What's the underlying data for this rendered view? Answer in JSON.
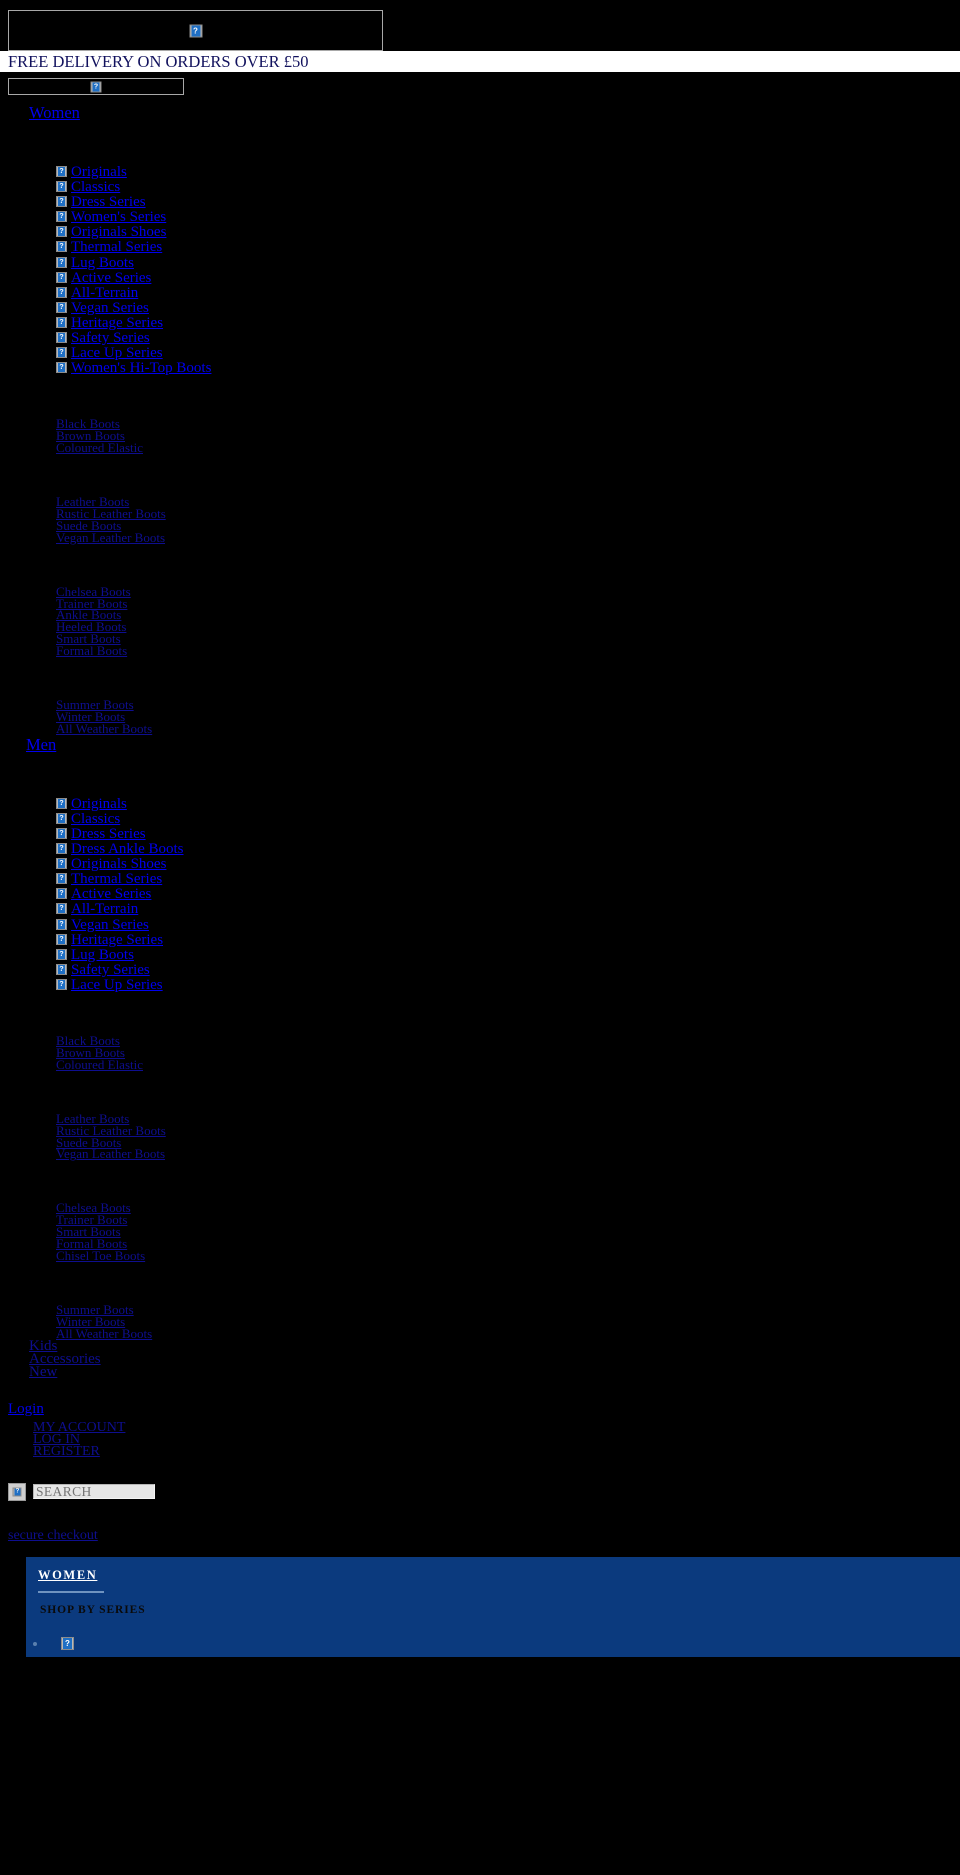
{
  "promo": {
    "text": "FREE DELIVERY ON ORDERS OVER £50"
  },
  "icons": {
    "broken": "broken-image-placeholder",
    "search": "search-icon"
  },
  "nav": {
    "women_label": "Women",
    "men_label": "Men",
    "kids_label": "Kids",
    "accessories_label": "Accessories",
    "new_label": "New",
    "women_series": [
      "Originals",
      "Classics",
      "Dress Series",
      "Women's Series",
      "Originals Shoes",
      "Thermal Series",
      "Lug Boots",
      "Active Series",
      "All-Terrain",
      "Vegan Series",
      "Heritage Series",
      "Safety Series",
      "Lace Up Series",
      "Women's Hi-Top Boots"
    ],
    "women_colour": [
      "Black Boots",
      "Brown Boots",
      "Coloured Elastic"
    ],
    "women_material": [
      "Leather Boots",
      "Rustic Leather Boots",
      "Suede Boots",
      "Vegan Leather Boots"
    ],
    "women_style": [
      "Chelsea Boots",
      "Trainer Boots",
      "Ankle Boots",
      "Heeled Boots",
      "Smart Boots",
      "Formal Boots"
    ],
    "women_season": [
      "Summer Boots",
      "Winter Boots",
      "All Weather Boots"
    ],
    "men_series": [
      "Originals",
      "Classics",
      "Dress Series",
      "Dress Ankle Boots",
      "Originals Shoes",
      "Thermal Series",
      "Active Series",
      "All-Terrain",
      "Vegan Series",
      "Heritage Series",
      "Lug Boots",
      "Safety Series",
      "Lace Up Series"
    ],
    "men_colour": [
      "Black Boots",
      "Brown Boots",
      "Coloured Elastic"
    ],
    "men_material": [
      "Leather Boots",
      "Rustic Leather Boots",
      "Suede Boots",
      "Vegan Leather Boots"
    ],
    "men_style": [
      "Chelsea Boots",
      "Trainer Boots",
      "Smart Boots",
      "Formal Boots",
      "Chisel Toe Boots"
    ],
    "men_season": [
      "Summer Boots",
      "Winter Boots",
      "All Weather Boots"
    ]
  },
  "account": {
    "login_label": "Login",
    "items": [
      "MY ACCOUNT",
      "LOG IN",
      "REGISTER"
    ]
  },
  "search": {
    "placeholder": "SEARCH"
  },
  "footer": {
    "secure_checkout": "secure checkout"
  },
  "panel": {
    "title": "WOMEN",
    "subtitle": "SHOP BY SERIES",
    "bg_color": "#0b3a7e"
  }
}
